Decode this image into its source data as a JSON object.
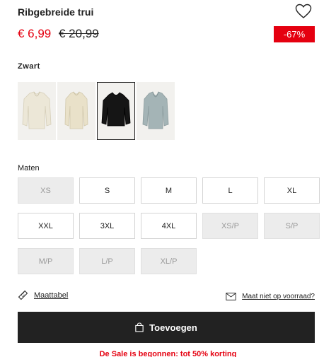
{
  "product": {
    "title": "Ribgebreide trui",
    "price_sale": "€ 6,99",
    "price_old": "€ 20,99",
    "discount_badge": "-67%"
  },
  "colors": {
    "selected_name": "Zwart",
    "swatches": [
      {
        "name": "cream-cardigan",
        "color": "#ece7d7"
      },
      {
        "name": "cream-sweater",
        "color": "#e9e1c9"
      },
      {
        "name": "black-sweater",
        "color": "#151515",
        "selected": true
      },
      {
        "name": "grey-blue-sweater",
        "color": "#a4b4b6"
      }
    ]
  },
  "sizes": {
    "label": "Maten",
    "options": [
      {
        "label": "XS",
        "available": false
      },
      {
        "label": "S",
        "available": true
      },
      {
        "label": "M",
        "available": true
      },
      {
        "label": "L",
        "available": true
      },
      {
        "label": "XL",
        "available": true
      },
      {
        "label": "XXL",
        "available": true
      },
      {
        "label": "3XL",
        "available": true
      },
      {
        "label": "4XL",
        "available": true
      },
      {
        "label": "XS/P",
        "available": false
      },
      {
        "label": "S/P",
        "available": false
      },
      {
        "label": "M/P",
        "available": false
      },
      {
        "label": "L/P",
        "available": false
      },
      {
        "label": "XL/P",
        "available": false
      }
    ]
  },
  "links": {
    "size_guide": "Maattabel",
    "notify": "Maat niet op voorraad?"
  },
  "actions": {
    "add_label": "Toevoegen"
  },
  "promo": {
    "text": "De Sale is begonnen: tot 50% korting"
  },
  "icons": {
    "favorite": "heart-icon",
    "size_guide": "ruler-icon",
    "notify": "envelope-icon",
    "add": "shopping-bag-icon"
  },
  "theme": {
    "accent": "#e50010",
    "button_bg": "#222222"
  }
}
